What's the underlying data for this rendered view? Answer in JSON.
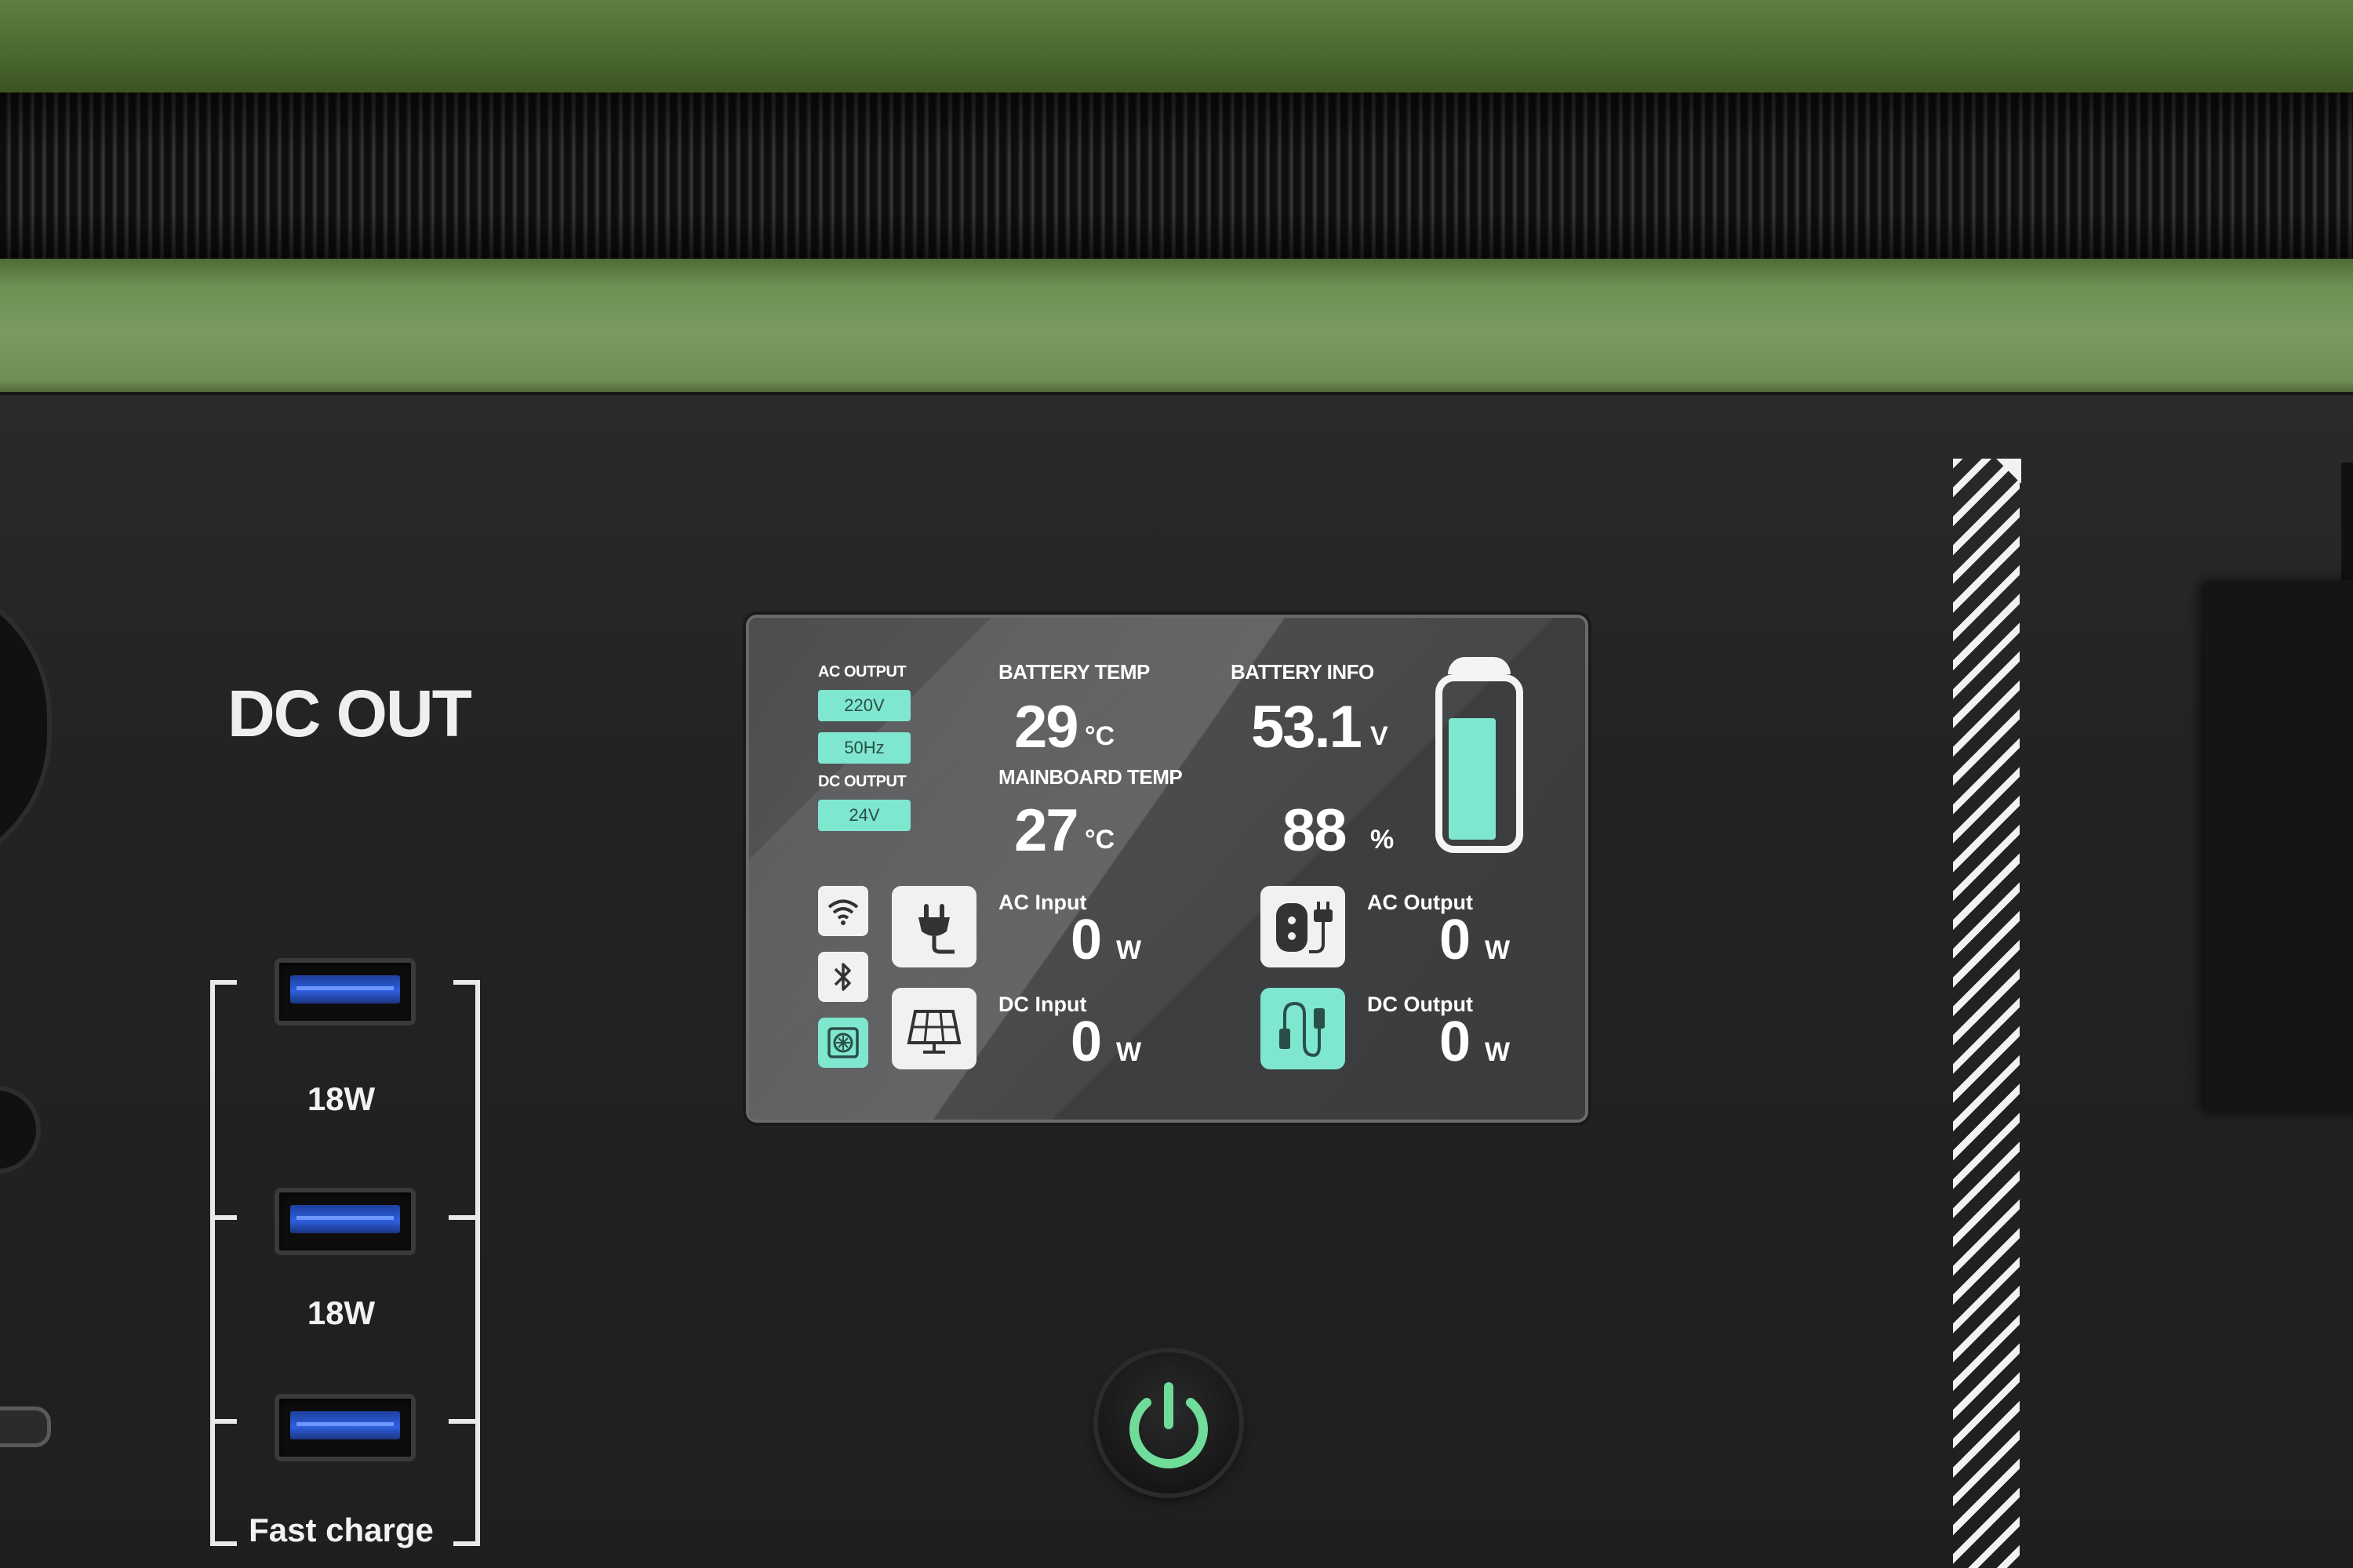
{
  "panel": {
    "dc_out_title": "DC OUT",
    "usb_ports": [
      {
        "label": "18W"
      },
      {
        "label": "18W"
      },
      {
        "label": "Fast charge"
      }
    ]
  },
  "screen": {
    "ac_output_label": "AC OUTPUT",
    "ac_voltage": "220V",
    "ac_frequency": "50Hz",
    "dc_output_label": "DC OUTPUT",
    "dc_voltage": "24V",
    "battery_temp": {
      "label": "BATTERY TEMP",
      "value": "29",
      "unit": "°C"
    },
    "mainboard_temp": {
      "label": "MAINBOARD TEMP",
      "value": "27",
      "unit": "°C"
    },
    "battery_info": {
      "label": "BATTERY INFO",
      "voltage": "53.1",
      "voltage_unit": "V",
      "percent": "88",
      "percent_unit": "%",
      "level_fraction": 0.88
    },
    "ac_input": {
      "label": "AC Input",
      "value": "0",
      "unit": "W"
    },
    "dc_input": {
      "label": "DC Input",
      "value": "0",
      "unit": "W"
    },
    "ac_output": {
      "label": "AC Output",
      "value": "0",
      "unit": "W"
    },
    "dc_output": {
      "label": "DC Output",
      "value": "0",
      "unit": "W"
    },
    "status_icons": [
      "wifi-icon",
      "bluetooth-icon",
      "fan-icon"
    ],
    "accent_color": "#7fe6cf"
  },
  "power_button": {
    "icon": "power-icon",
    "color": "#6fdc9a"
  }
}
